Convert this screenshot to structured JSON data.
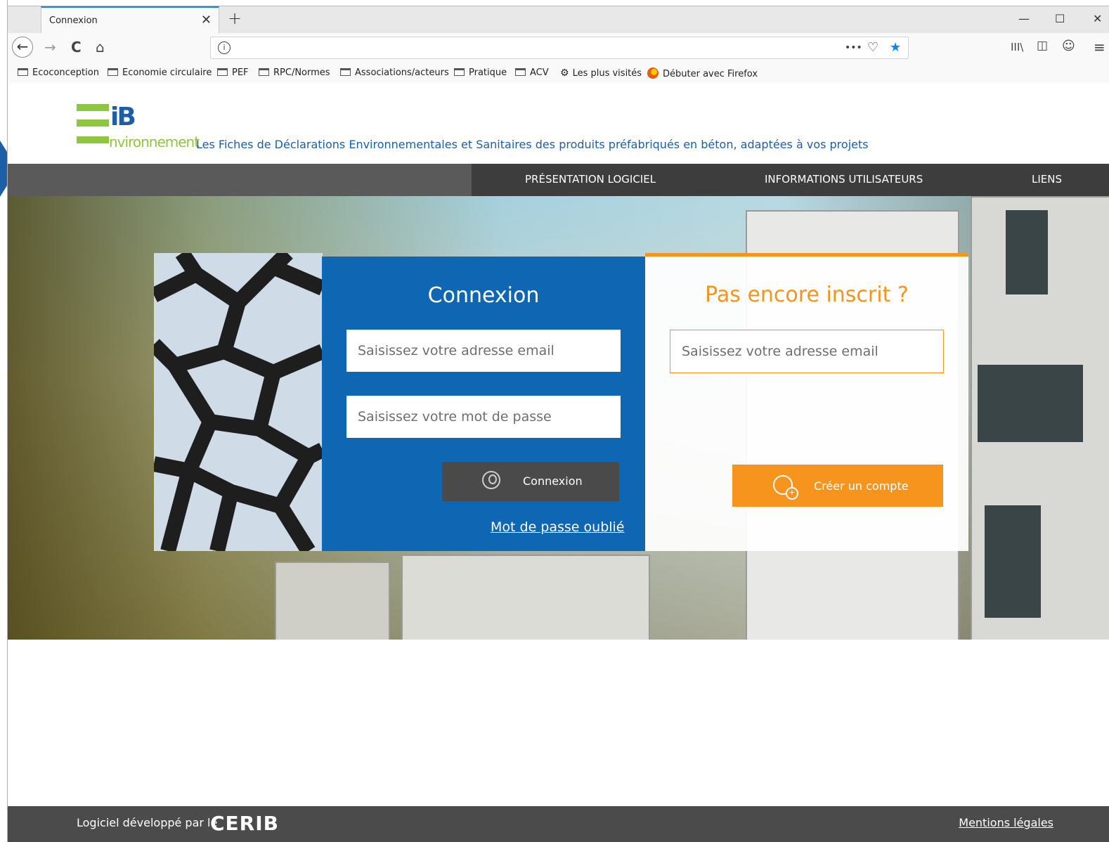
{
  "browser": {
    "tab_title": "Connexion",
    "tab_close": "✕",
    "new_tab": "+",
    "controls": {
      "minimize": "—",
      "maximize": "☐",
      "close": "✕"
    },
    "nav": {
      "back": "←",
      "forward": "→",
      "reload": "C",
      "home": "⌂"
    },
    "url_icons": {
      "info": "i",
      "more": "•••",
      "pocket": "♡",
      "bookmark": "★"
    },
    "toolbar_icons": {
      "library": "III\\",
      "sidebar": "◫",
      "account": "☺",
      "menu": "≡"
    }
  },
  "bookmarks": [
    {
      "label": "Ecoconception",
      "icon": "folder-icon"
    },
    {
      "label": "Economie circulaire",
      "icon": "folder-icon"
    },
    {
      "label": "PEF",
      "icon": "folder-icon"
    },
    {
      "label": "RPC/Normes",
      "icon": "folder-icon"
    },
    {
      "label": "Associations/acteurs",
      "icon": "folder-icon"
    },
    {
      "label": "Pratique",
      "icon": "folder-icon"
    },
    {
      "label": "ACV",
      "icon": "folder-icon"
    },
    {
      "label": "Les plus visités",
      "icon": "gear-icon"
    },
    {
      "label": "Débuter avec Firefox",
      "icon": "firefox-icon"
    }
  ],
  "site": {
    "logo_text": "iB",
    "logo_word": "nvironnement",
    "tagline": "Les Fiches de Déclarations Environnementales et Sanitaires des produits préfabriqués en béton, adaptées à vos projets",
    "menu": [
      "PRÉSENTATION LOGICIEL",
      "INFORMATIONS UTILISATEURS",
      "LIENS"
    ]
  },
  "login": {
    "title": "Connexion",
    "email_placeholder": "Saisissez votre adresse email",
    "password_placeholder": "Saisissez votre mot de passe",
    "button": "Connexion",
    "forgot": "Mot de passe oublié"
  },
  "signup": {
    "title": "Pas encore inscrit ?",
    "email_placeholder": "Saisissez votre adresse email",
    "button": "Créer un compte"
  },
  "footer": {
    "developed_by": "Logiciel développé par le",
    "brand": "CERIB",
    "legal": "Mentions légales"
  },
  "colors": {
    "brand_blue": "#0f66b3",
    "brand_green": "#8dc63f",
    "accent_orange": "#f7941d",
    "menu_dark": "#3d3d3d"
  }
}
